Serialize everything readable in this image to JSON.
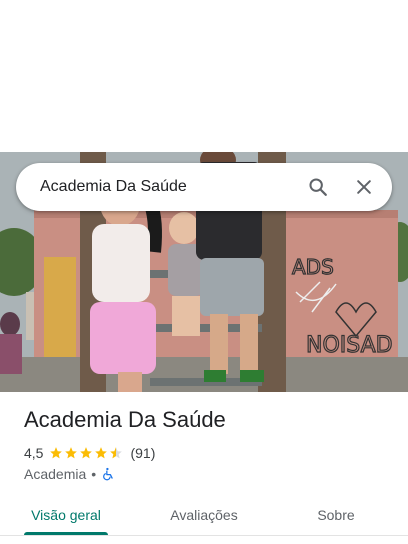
{
  "search": {
    "query": "Academia Da Saúde",
    "search_icon": "search-icon",
    "close_icon": "close-icon"
  },
  "place": {
    "title": "Academia Da Saúde",
    "rating": "4,5",
    "stars": 4.5,
    "review_count": "(91)",
    "category": "Academia",
    "separator": "•",
    "accessibility_icon": "wheelchair-accessible-icon"
  },
  "tabs": [
    {
      "label": "Visão geral",
      "active": true
    },
    {
      "label": "Avaliações",
      "active": false
    },
    {
      "label": "Sobre",
      "active": false
    }
  ],
  "colors": {
    "accent": "#00796b",
    "star": "#fbbc04",
    "accessibility": "#1a73e8"
  }
}
